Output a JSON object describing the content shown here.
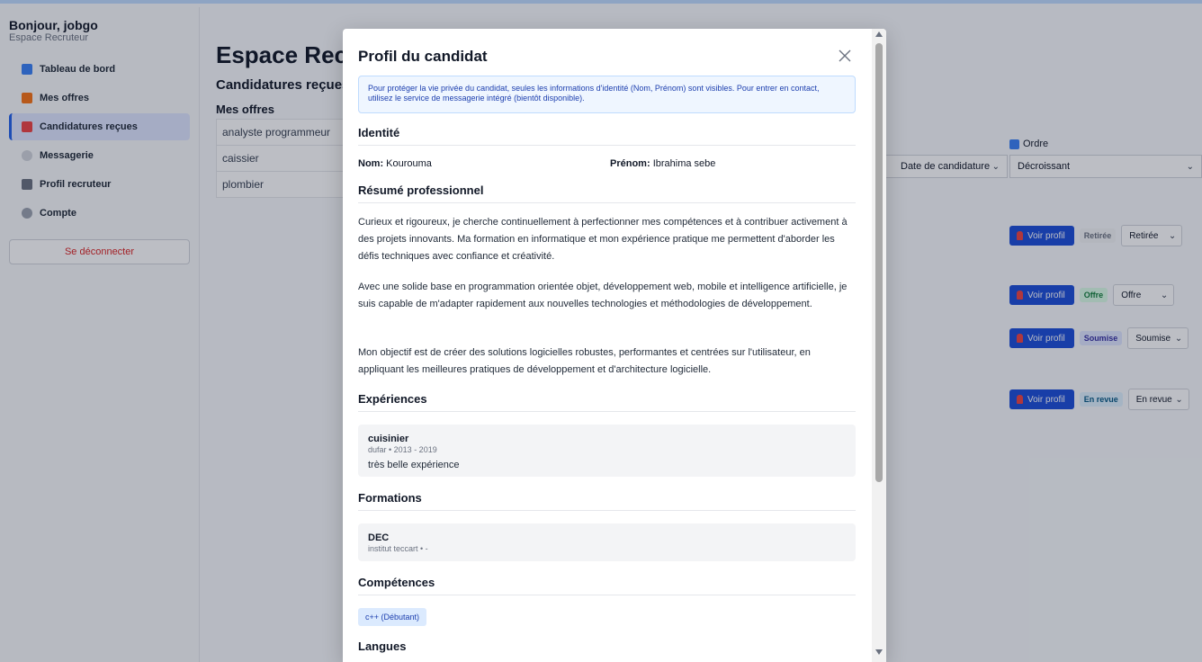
{
  "sidebar": {
    "greeting": "Bonjour, jobgo",
    "subtitle": "Espace Recruteur",
    "items": [
      {
        "label": "Tableau de bord",
        "icon": "dashboard-icon",
        "color": "#3b82f6"
      },
      {
        "label": "Mes offres",
        "icon": "offers-icon",
        "color": "#f97316"
      },
      {
        "label": "Candidatures reçues",
        "icon": "applications-icon",
        "color": "#ef4444"
      },
      {
        "label": "Messagerie",
        "icon": "message-icon",
        "color": "#d1d5db"
      },
      {
        "label": "Profil recruteur",
        "icon": "profile-icon",
        "color": "#6b7280"
      },
      {
        "label": "Compte",
        "icon": "gear-icon",
        "color": "#9ca3af"
      }
    ],
    "logout": "Se déconnecter"
  },
  "main": {
    "title": "Espace Recruteur",
    "subtitle": "Candidatures reçues",
    "offers_label": "Mes offres",
    "offers": [
      "analyste programmeur",
      "caissier",
      "plombier"
    ],
    "sort_value": "Date de candidature",
    "order_label": "Ordre",
    "order_value": "Décroissant",
    "candidates": [
      {
        "button": "Voir profil",
        "badge": "Retirée",
        "status": "Retirée",
        "badge_bg": "#f3f4f6",
        "badge_fg": "#6b7280"
      },
      {
        "button": "Voir profil",
        "badge": "Offre",
        "status": "Offre",
        "badge_bg": "#dcfce7",
        "badge_fg": "#15803d"
      },
      {
        "button": "Voir profil",
        "badge": "Soumise",
        "status": "Soumise",
        "badge_bg": "#e0e7ff",
        "badge_fg": "#3730a3"
      },
      {
        "button": "Voir profil",
        "badge": "En revue",
        "status": "En revue",
        "badge_bg": "#e0f2fe",
        "badge_fg": "#075985"
      }
    ]
  },
  "modal": {
    "title": "Profil du candidat",
    "notice": "Pour protéger la vie privée du candidat, seules les informations d'identité (Nom, Prénom) sont visibles. Pour entrer en contact, utilisez le service de messagerie intégré (bientôt disponible).",
    "identity": {
      "heading": "Identité",
      "nom_label": "Nom:",
      "nom": "Kourouma",
      "prenom_label": "Prénom:",
      "prenom": "Ibrahima sebe"
    },
    "summary": {
      "heading": "Résumé professionnel",
      "paragraphs": [
        "Curieux et rigoureux, je cherche continuellement à perfectionner mes compétences et à contribuer activement à des projets innovants. Ma formation en informatique et mon expérience pratique me permettent d'aborder les défis techniques avec confiance et créativité.",
        "Avec une solide base en programmation orientée objet, développement web, mobile et intelligence artificielle, je suis capable de m'adapter rapidement aux nouvelles technologies et méthodologies de développement.",
        "Mon objectif est de créer des solutions logicielles robustes, performantes et centrées sur l'utilisateur, en appliquant les meilleures pratiques de développement et d'architecture logicielle."
      ]
    },
    "experiences": {
      "heading": "Expériences",
      "items": [
        {
          "title": "cuisinier",
          "meta": "dufar • 2013 - 2019",
          "description": "très belle expérience"
        }
      ]
    },
    "formations": {
      "heading": "Formations",
      "items": [
        {
          "title": "DEC",
          "meta": "institut teccart • -"
        }
      ]
    },
    "competences": {
      "heading": "Compétences",
      "items": [
        "c++ (Débutant)"
      ]
    },
    "langues": {
      "heading": "Langues"
    }
  }
}
